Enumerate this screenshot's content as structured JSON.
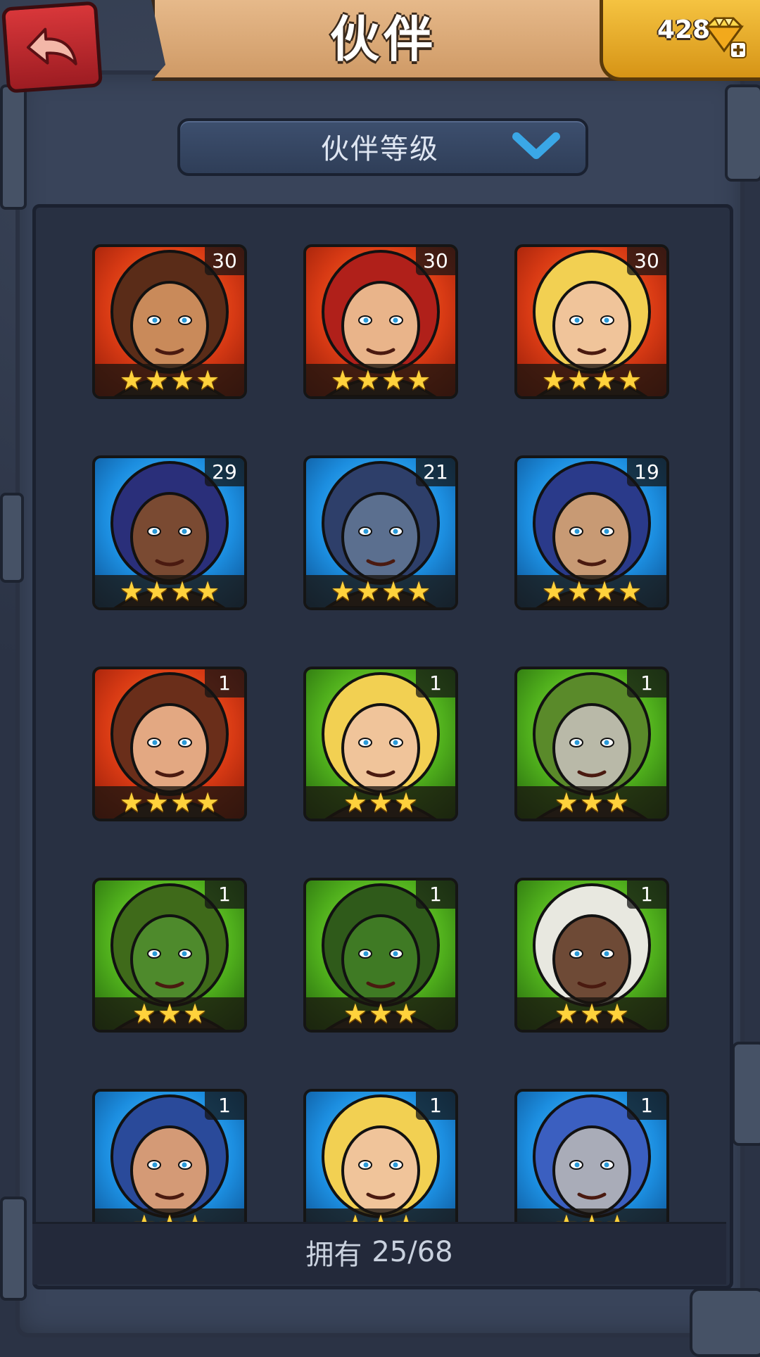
{
  "header": {
    "title": "伙伴",
    "gem_count": "428",
    "back_icon": "back-arrow-icon",
    "gem_icon": "diamond-plus-icon"
  },
  "filter": {
    "label": "伙伴等级",
    "chevron_icon": "chevron-down-icon"
  },
  "companions": [
    {
      "level": "30",
      "stars": 4,
      "frame": "red"
    },
    {
      "level": "30",
      "stars": 4,
      "frame": "red"
    },
    {
      "level": "30",
      "stars": 4,
      "frame": "red"
    },
    {
      "level": "29",
      "stars": 4,
      "frame": "blue"
    },
    {
      "level": "21",
      "stars": 4,
      "frame": "blue"
    },
    {
      "level": "19",
      "stars": 4,
      "frame": "blue"
    },
    {
      "level": "1",
      "stars": 4,
      "frame": "red"
    },
    {
      "level": "1",
      "stars": 3,
      "frame": "green"
    },
    {
      "level": "1",
      "stars": 3,
      "frame": "green"
    },
    {
      "level": "1",
      "stars": 3,
      "frame": "green"
    },
    {
      "level": "1",
      "stars": 3,
      "frame": "green"
    },
    {
      "level": "1",
      "stars": 3,
      "frame": "green"
    },
    {
      "level": "1",
      "stars": 3,
      "frame": "blue"
    },
    {
      "level": "1",
      "stars": 3,
      "frame": "blue"
    },
    {
      "level": "1",
      "stars": 3,
      "frame": "blue"
    }
  ],
  "footer": {
    "owned_label": "拥有",
    "owned_count": "25/68"
  },
  "colors": {
    "red_frame": "#d83a14",
    "blue_frame": "#1c8ee0",
    "green_frame": "#4fae1c",
    "star": "#ffd23c"
  }
}
